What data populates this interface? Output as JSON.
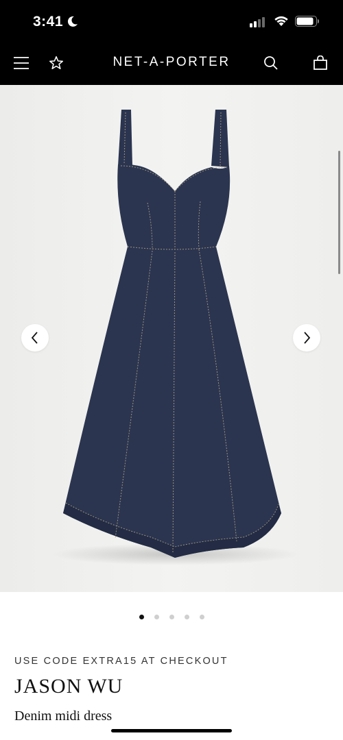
{
  "status_bar": {
    "time": "3:41"
  },
  "nav": {
    "brand": "NET-A-PORTER",
    "icons": [
      "menu-icon",
      "star-icon",
      "search-icon",
      "shopping-bag-icon"
    ]
  },
  "gallery": {
    "image_count": 5,
    "active_index": 0,
    "prev_icon": "chevron-left-icon",
    "next_icon": "chevron-right-icon"
  },
  "product": {
    "promo": "USE CODE EXTRA15 AT CHECKOUT",
    "designer": "JASON WU",
    "name": "Denim midi dress"
  },
  "colors": {
    "header_bg": "#000000",
    "dress": "#2b3550",
    "stitching": "#b8a98a",
    "image_bg": "#efefed"
  }
}
